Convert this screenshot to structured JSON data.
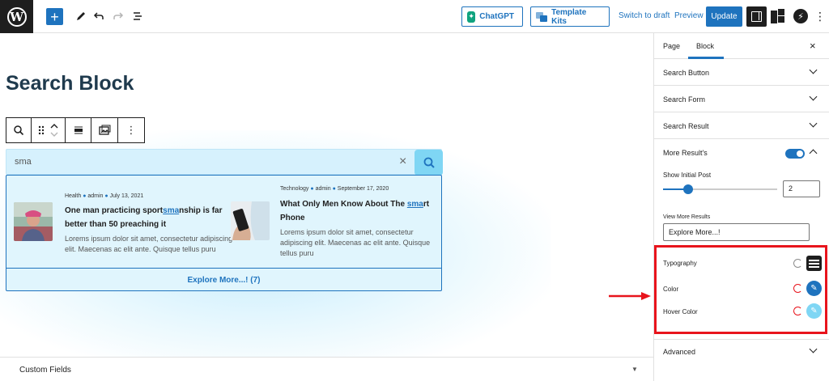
{
  "topbar": {
    "logo": "W",
    "add": "+",
    "chatgpt_label": "ChatGPT",
    "template_kits_label": "Template Kits",
    "switch_draft": "Switch to draft",
    "preview": "Preview",
    "update": "Update"
  },
  "canvas": {
    "page_title": "Search Block",
    "search_value": "sma",
    "clear": "×",
    "results": [
      {
        "category": "Health",
        "author": "admin",
        "date": "July 13, 2021",
        "title_before": "One man practicing sport",
        "title_highlight": "sma",
        "title_after": "nship is far better than 50 preaching it",
        "excerpt": "Lorems ipsum dolor sit amet, consectetur adipiscing elit. Maecenas ac elit ante. Quisque tellus puru"
      },
      {
        "category": "Technology",
        "author": "admin",
        "date": "September 17, 2020",
        "title_before": "What Only Men Know About The ",
        "title_highlight": "sma",
        "title_after": "rt Phone",
        "excerpt": "Lorems ipsum dolor sit amet, consectetur adipiscing elit. Maecenas ac elit ante. Quisque tellus puru"
      }
    ],
    "explore": "Explore More...! (7)",
    "custom_fields": "Custom Fields"
  },
  "sidebar": {
    "tabs": [
      "Page",
      "Block"
    ],
    "close": "×",
    "sections": [
      "Search Button",
      "Search Form",
      "Search Result",
      "More Result's"
    ],
    "show_initial_post": "Show Initial Post",
    "initial_post_value": "2",
    "initial_post_fraction": 0.22,
    "view_more_results": "View More Results",
    "view_more_value": "Explore More...!",
    "typography": "Typography",
    "color": "Color",
    "hover_color": "Hover Color",
    "advanced": "Advanced"
  },
  "colors": {
    "accent": "#1e73be",
    "highlight_border": "#e8141c",
    "color_swatch": "#1e73be",
    "hover_swatch": "#7fd6f4"
  }
}
